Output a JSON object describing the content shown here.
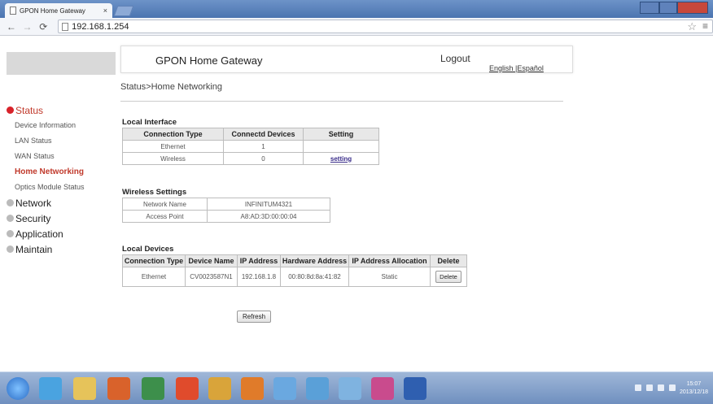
{
  "browser": {
    "tab_title": "GPON Home Gateway",
    "tab_close": "×",
    "url": "192.168.1.254"
  },
  "header": {
    "title": "GPON Home Gateway",
    "logout": "Logout",
    "languages": "English |Español"
  },
  "breadcrumb": "Status>Home Networking",
  "sidebar": {
    "status": "Status",
    "items": [
      "Device Information",
      "LAN Status",
      "WAN Status",
      "Home Networking",
      "Optics Module Status"
    ],
    "network": "Network",
    "security": "Security",
    "application": "Application",
    "maintain": "Maintain"
  },
  "local_interface": {
    "title": "Local Interface",
    "headers": [
      "Connection Type",
      "Connectd Devices",
      "Setting"
    ],
    "rows": [
      {
        "type": "Ethernet",
        "devices": "1",
        "setting": ""
      },
      {
        "type": "Wireless",
        "devices": "0",
        "setting": "setting"
      }
    ]
  },
  "wireless": {
    "title": "Wireless Settings",
    "rows": [
      {
        "label": "Network Name",
        "value": "INFINITUM4321"
      },
      {
        "label": "Access Point",
        "value": "A8:AD:3D:00:00:04"
      }
    ]
  },
  "local_devices": {
    "title": "Local Devices",
    "headers": [
      "Connection Type",
      "Device Name",
      "IP Address",
      "Hardware Address",
      "IP Address Allocation",
      "Delete"
    ],
    "row": {
      "type": "Ethernet",
      "name": "CV0023587N1",
      "ip": "192.168.1.8",
      "mac": "00:80:8d:8a:41:82",
      "allocation": "Static",
      "delete": "Delete"
    }
  },
  "refresh": "Refresh",
  "clock": {
    "time": "15:07",
    "date": "2013/12/18"
  },
  "colors": {
    "accent_red": "#d8222a",
    "link": "#3a2d8a",
    "taskbar": "#6f8fbf"
  },
  "icons": [
    "back-icon",
    "forward-icon",
    "reload-icon",
    "star-icon",
    "menu-icon",
    "bullet-icon"
  ]
}
